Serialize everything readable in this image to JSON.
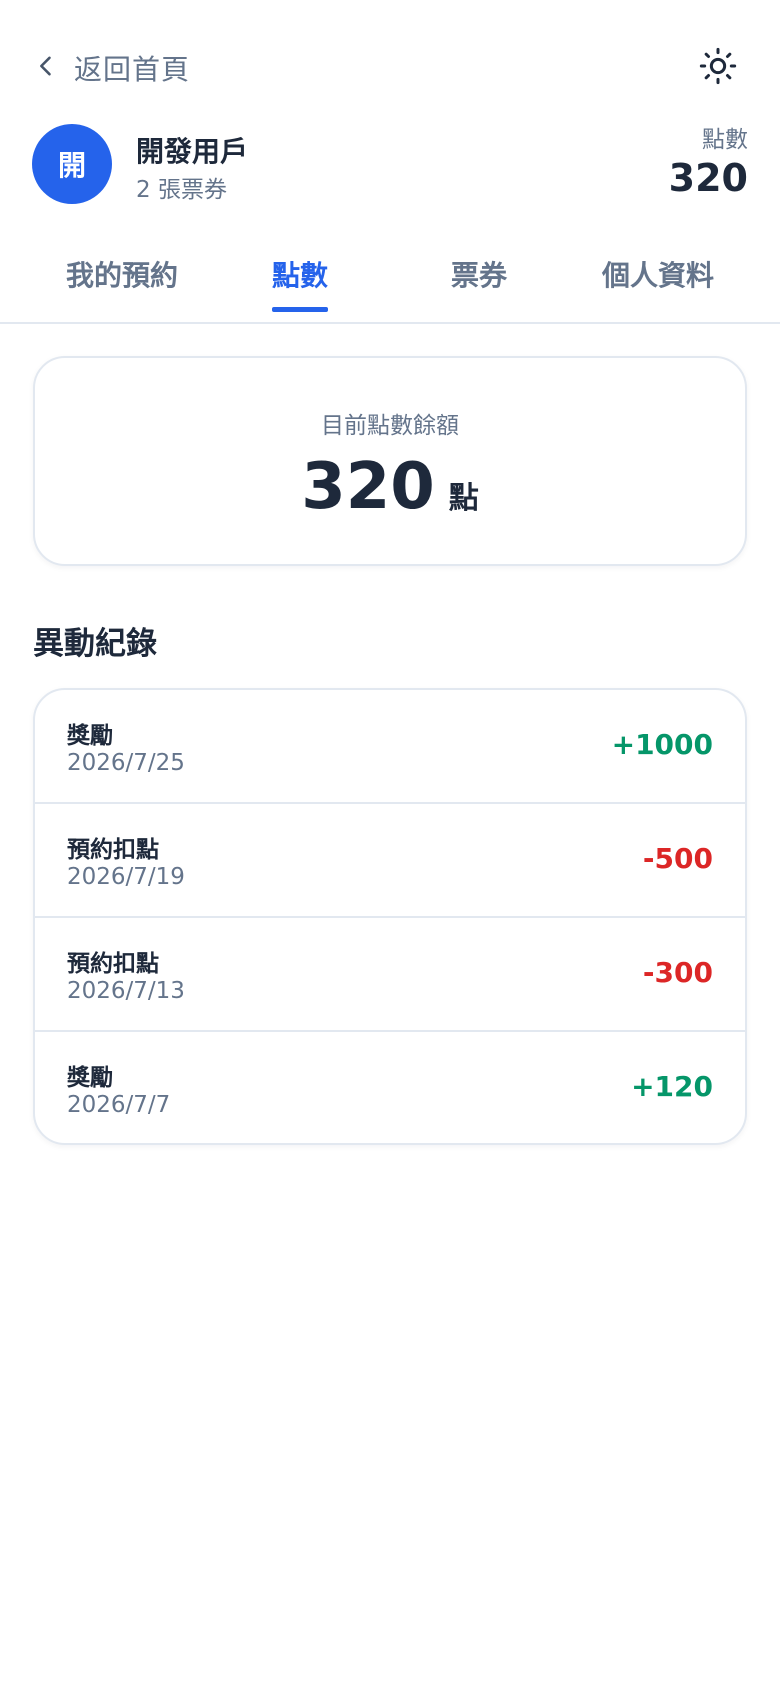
{
  "colors": {
    "accent": "#2563eb",
    "positive": "#059669",
    "negative": "#dc2626"
  },
  "header": {
    "back_label": "返回首頁",
    "back_icon": "chevron-left-icon",
    "theme_icon": "sun-icon"
  },
  "profile": {
    "avatar_text": "開",
    "name": "開發用戶",
    "subtitle": "2 張票券",
    "points_label": "點數",
    "points_value": "320"
  },
  "tabs": [
    {
      "label": "我的預約",
      "active": false
    },
    {
      "label": "點數",
      "active": true
    },
    {
      "label": "票券",
      "active": false
    },
    {
      "label": "個人資料",
      "active": false
    }
  ],
  "balance": {
    "label": "目前點數餘額",
    "value": "320",
    "unit": "點"
  },
  "history": {
    "title": "異動紀錄",
    "items": [
      {
        "title": "獎勵",
        "date": "2026/7/25",
        "amount": "+1000",
        "type": "positive"
      },
      {
        "title": "預約扣點",
        "date": "2026/7/19",
        "amount": "-500",
        "type": "negative"
      },
      {
        "title": "預約扣點",
        "date": "2026/7/13",
        "amount": "-300",
        "type": "negative"
      },
      {
        "title": "獎勵",
        "date": "2026/7/7",
        "amount": "+120",
        "type": "positive"
      }
    ]
  }
}
